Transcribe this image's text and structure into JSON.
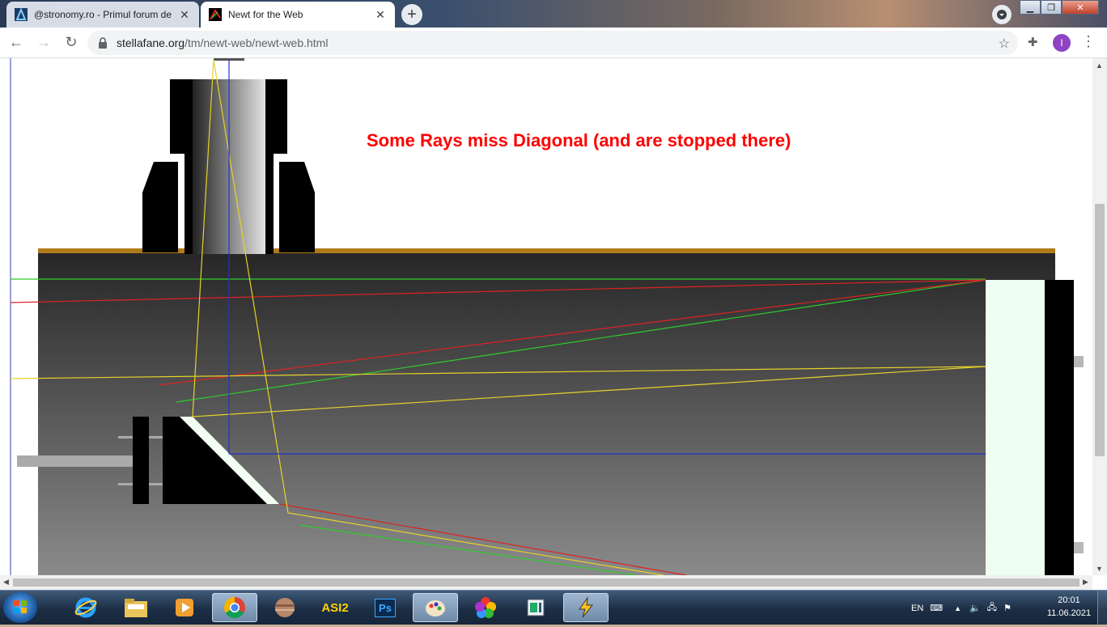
{
  "browser": {
    "tabs": [
      {
        "title": "@stronomy.ro - Primul forum de",
        "active": false,
        "favicon": "astronomy-logo-icon"
      },
      {
        "title": "Newt for the Web",
        "active": true,
        "favicon": "newt-icon"
      }
    ],
    "new_tab": "+",
    "url_host": "stellafane.org",
    "url_path": "/tm/newt-web/newt-web.html",
    "profile_initial": "I"
  },
  "page": {
    "annotation": "Some Rays miss Diagonal (and are stopped there)",
    "annotation_color": "#ff0000",
    "tube_color": "#2a2a2a",
    "tube_edge_color": "#b07a1a",
    "primary_mirror_color": "#eefff2",
    "ray_colors": {
      "green": "#2ecc2e",
      "red": "#dd2222",
      "yellow": "#e6d22a",
      "axis": "#2233cc"
    }
  },
  "taskbar": {
    "apps": [
      "internet-explorer-icon",
      "file-explorer-icon",
      "media-player-icon",
      "chrome-icon",
      "planet-app-icon",
      "asi-app-icon",
      "photoshop-icon",
      "paint-icon",
      "colors-icon",
      "document-icon",
      "winamp-icon"
    ],
    "asi_label": "ASI2",
    "ps_label": "Ps",
    "language": "EN",
    "time": "20:01",
    "date": "11.06.2021"
  }
}
